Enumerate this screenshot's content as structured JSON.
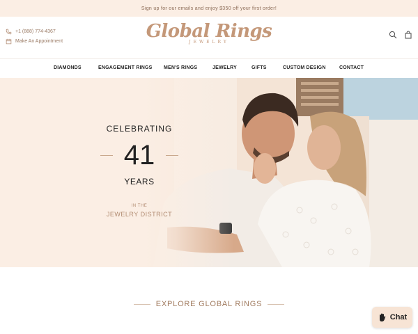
{
  "announcement": "Sign up for our emails and enjoy $350 off your first order!",
  "contact": {
    "phone": "+1 (888) 774-4367",
    "appointment": "Make An Appointment"
  },
  "logo": {
    "main": "Global Rings",
    "sub": "JEWELRY"
  },
  "header_icons": [
    "search-icon",
    "bag-icon"
  ],
  "nav": {
    "items": [
      {
        "label": "DIAMONDS"
      },
      {
        "label": "ENGAGEMENT RINGS"
      },
      {
        "label": "MEN'S RINGS"
      },
      {
        "label": "JEWELRY"
      },
      {
        "label": "GIFTS"
      },
      {
        "label": "CUSTOM DESIGN"
      },
      {
        "label": "CONTACT"
      }
    ]
  },
  "hero": {
    "celebrating": "CELEBRATING",
    "years_number": "41",
    "years_word": "YEARS",
    "in_the": "IN THE",
    "district": "JEWELRY DISTRICT"
  },
  "explore": "EXPLORE GLOBAL RINGS",
  "chat": {
    "label": "Chat"
  },
  "colors": {
    "accent": "#c49879",
    "announcement_bg": "#fbeee4",
    "chat_bg": "#f7e4d5"
  }
}
